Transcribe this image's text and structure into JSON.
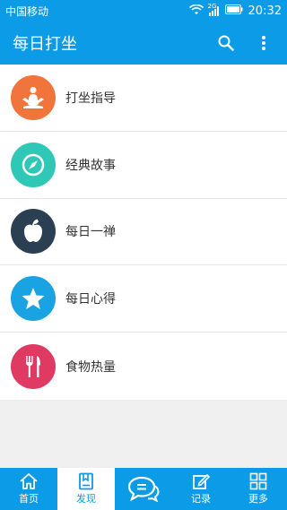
{
  "status_bar": {
    "carrier": "中国移动",
    "network": "2G",
    "time": "20:32"
  },
  "app_bar": {
    "title": "每日打坐",
    "search_icon": "search-icon",
    "more_icon": "more-vert-icon"
  },
  "menu": {
    "items": [
      {
        "label": "打坐指导",
        "icon": "meditation-icon",
        "color": "#f0743c"
      },
      {
        "label": "经典故事",
        "icon": "compass-icon",
        "color": "#2fc7b6"
      },
      {
        "label": "每日一禅",
        "icon": "apple-icon",
        "color": "#2b3f52"
      },
      {
        "label": "每日心得",
        "icon": "star-icon",
        "color": "#1aa3e3"
      },
      {
        "label": "食物热量",
        "icon": "fork-knife-icon",
        "color": "#de3a62"
      }
    ]
  },
  "tabbar": {
    "active": "发现",
    "tabs": [
      {
        "label": "首页",
        "icon": "home-icon"
      },
      {
        "label": "发现",
        "icon": "book-icon"
      },
      {
        "label": "",
        "icon": "chat-icon"
      },
      {
        "label": "记录",
        "icon": "edit-icon"
      },
      {
        "label": "更多",
        "icon": "grid-icon"
      }
    ]
  },
  "colors": {
    "primary": "#0c9be6",
    "background": "#f0f0f0"
  }
}
